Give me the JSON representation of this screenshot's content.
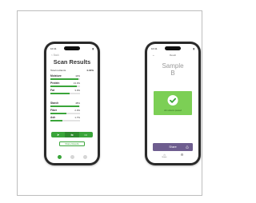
{
  "scan_screen": {
    "time": "10:41",
    "back_label": "< Back",
    "title": "Scan Results",
    "total_label": "Total nutrients",
    "total_value": "4.43%",
    "nutrients": [
      {
        "label": "Moisture",
        "value": "10%",
        "fraction": 0.95
      },
      {
        "label": "Protein",
        "value": "13.0%",
        "fraction": 0.88
      },
      {
        "label": "Fat",
        "value": "3.0%",
        "fraction": 0.65
      },
      {
        "label": "Starch",
        "value": "48%",
        "fraction": 0.98
      },
      {
        "label": "Fiber",
        "value": "2.0%",
        "fraction": 0.55
      },
      {
        "label": "Ash",
        "value": "1.7%",
        "fraction": 0.4
      }
    ],
    "share_label": "Share Results",
    "accent": "#3aa53a"
  },
  "sample_screen": {
    "time": "10:41",
    "header": "Result",
    "sample_title": "Sample",
    "sample_id": "B",
    "result_text": "All nutrients passed",
    "share_label": "Share",
    "nav": [
      {
        "label": "Home",
        "icon": "home-icon"
      },
      {
        "label": "",
        "icon": "settings-icon"
      }
    ],
    "result_color": "#7ccf55",
    "share_color": "#6e5d8f"
  }
}
